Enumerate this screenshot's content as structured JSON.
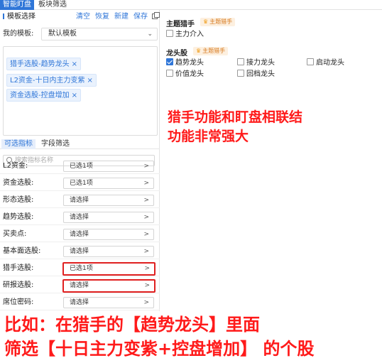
{
  "top_tabs": [
    "智能盯盘",
    "板块筛选"
  ],
  "template": {
    "title": "模板选择",
    "actions": [
      "清空",
      "恢复",
      "新建",
      "保存"
    ],
    "my_template_label": "我的模板:",
    "my_template_value": "默认模板",
    "tags": [
      "猎手选股-趋势龙头",
      "L2资金-十日内主力变紫",
      "资金选股-控盘增加"
    ]
  },
  "sub_tabs": [
    "可选指标",
    "字段筛选"
  ],
  "search_placeholder": "搜索指标名称",
  "filters": [
    {
      "label": "L2资金:",
      "value": "已选1项"
    },
    {
      "label": "资金选股:",
      "value": "已选1项"
    },
    {
      "label": "形态选股:",
      "value": "请选择"
    },
    {
      "label": "趋势选股:",
      "value": "请选择"
    },
    {
      "label": "买卖点:",
      "value": "请选择"
    },
    {
      "label": "基本面选股:",
      "value": "请选择"
    },
    {
      "label": "猎手选股:",
      "value": "已选1项"
    },
    {
      "label": "研报选股:",
      "value": "请选择"
    },
    {
      "label": "席位密码:",
      "value": "请选择"
    }
  ],
  "right": {
    "section1_title": "主题猎手",
    "section1_badge": "主题猎手",
    "section1_options": [
      "主力介入"
    ],
    "section2_title": "龙头股",
    "section2_badge": "主题猎手",
    "section2_options": [
      "趋势龙头",
      "接力龙头",
      "启动龙头",
      "价值龙头",
      "回档龙头"
    ]
  },
  "annotations": {
    "right_line1": "猎手功能和盯盘相联结",
    "right_line2": "功能非常强大",
    "bottom_line1": "比如：在猎手的【趋势龙头】里面",
    "bottom_line2": "筛选【十日主力变紫+控盘增加】 的个股"
  },
  "colors": {
    "accent": "#2f76d8",
    "annotation": "#ff1a1a",
    "badge": "#d77a20"
  }
}
